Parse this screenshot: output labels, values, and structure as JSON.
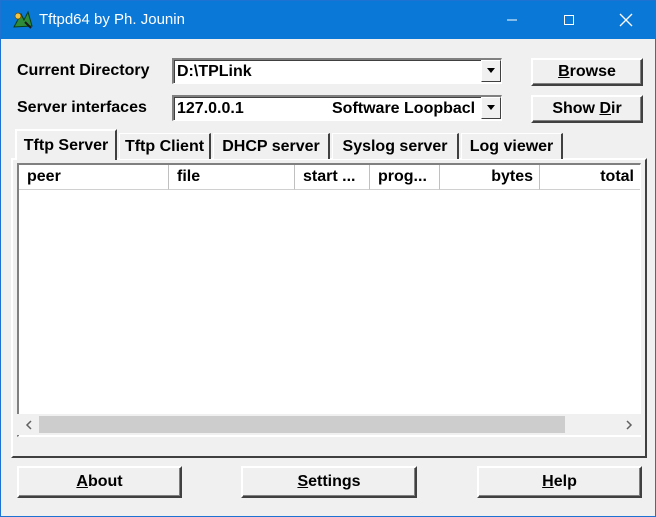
{
  "window": {
    "title": "Tftpd64 by Ph. Jounin"
  },
  "titlebar_buttons": [
    "minimize",
    "maximize",
    "close"
  ],
  "form": {
    "current_directory_label": "Current Directory",
    "current_directory_value": "D:\\TPLink",
    "server_interfaces_label": "Server interfaces",
    "server_interface_ip": "127.0.0.1",
    "server_interface_name": "Software Loopbacl"
  },
  "buttons": {
    "browse": {
      "first": "B",
      "rest": "rowse"
    },
    "show_dir": {
      "pre": "Show ",
      "ul": "D",
      "post": "ir"
    },
    "about": {
      "ul": "A",
      "rest": "bout"
    },
    "settings": {
      "ul": "S",
      "rest": "ettings"
    },
    "help": {
      "ul": "H",
      "rest": "elp"
    }
  },
  "tabs": [
    {
      "label": "Tftp Server",
      "active": true
    },
    {
      "label": "Tftp Client",
      "active": false
    },
    {
      "label": "DHCP server",
      "active": false
    },
    {
      "label": "Syslog server",
      "active": false
    },
    {
      "label": "Log viewer",
      "active": false
    }
  ],
  "table": {
    "columns": [
      "peer",
      "file",
      "start ...",
      "prog...",
      "bytes",
      "total"
    ],
    "rows": []
  },
  "colors": {
    "titlebar": "#0a78d7",
    "window_bg": "#f0f0f0"
  }
}
